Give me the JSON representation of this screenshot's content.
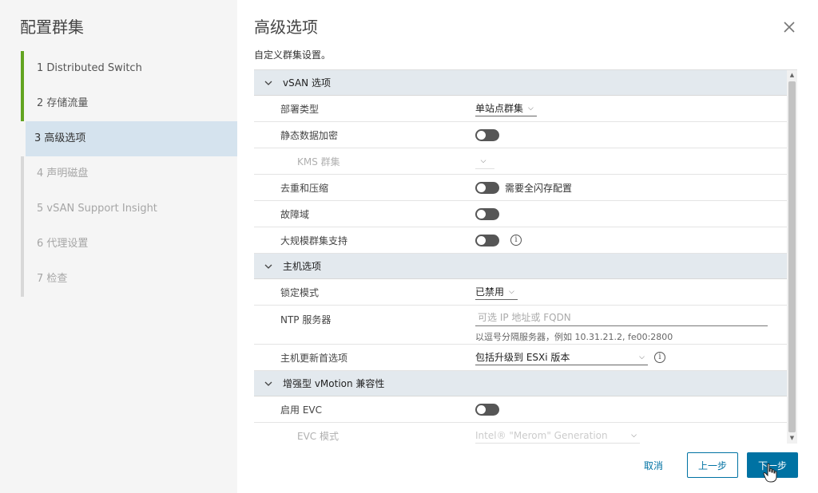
{
  "sidebar": {
    "title": "配置群集",
    "steps": [
      {
        "label": "1 Distributed Switch",
        "state": "done"
      },
      {
        "label": "2 存储流量",
        "state": "done"
      },
      {
        "label": "3 高级选项",
        "state": "active"
      },
      {
        "label": "4 声明磁盘",
        "state": "todo"
      },
      {
        "label": "5 vSAN Support Insight",
        "state": "todo"
      },
      {
        "label": "6 代理设置",
        "state": "todo"
      },
      {
        "label": "7 检查",
        "state": "todo"
      }
    ]
  },
  "main": {
    "title": "高级选项",
    "subtitle": "自定义群集设置。",
    "close_icon": "close-icon"
  },
  "vsan": {
    "header": "vSAN 选项",
    "deployment_type_label": "部署类型",
    "deployment_type_value": "单站点群集",
    "encryption_label": "静态数据加密",
    "kms_label": "KMS 群集",
    "dedup_label": "去重和压缩",
    "dedup_note": "需要全闪存配置",
    "fault_domain_label": "故障域",
    "large_cluster_label": "大规模群集支持"
  },
  "host": {
    "header": "主机选项",
    "lockdown_label": "锁定模式",
    "lockdown_value": "已禁用",
    "ntp_label": "NTP 服务器",
    "ntp_placeholder": "可选 IP 地址或 FQDN",
    "ntp_hint": "以逗号分隔服务器，例如 10.31.21.2, fe00:2800",
    "update_label": "主机更新首选项",
    "update_value": "包括升级到 ESXi 版本"
  },
  "evc": {
    "header": "增强型 vMotion 兼容性",
    "enable_label": "启用 EVC",
    "mode_label": "EVC 模式",
    "mode_value": "Intel® \"Merom\" Generation"
  },
  "footer": {
    "cancel": "取消",
    "back": "上一步",
    "next": "下一步"
  },
  "colors": {
    "accent": "#0072a3",
    "done_step": "#62a420",
    "active_step_bg": "#d5e3ee",
    "section_bg": "#e3e9ee",
    "toggle_off": "#565656"
  }
}
